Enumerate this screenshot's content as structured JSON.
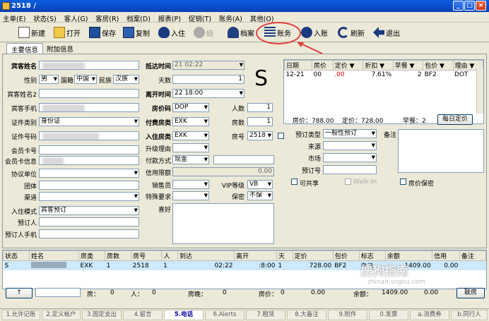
{
  "window": {
    "title": "2518 /"
  },
  "menu": [
    "主单(E)",
    "状态(S)",
    "客人(G)",
    "客房(R)",
    "档案(D)",
    "报表(P)",
    "促销(T)",
    "账务(A)",
    "其他(O)"
  ],
  "toolbar": {
    "new": "新建",
    "open": "打开",
    "save": "保存",
    "copy": "复制",
    "checkin": "入住",
    "guest": "档案",
    "account": "账务",
    "deposit": "入账",
    "refresh": "刷新",
    "exit": "退出"
  },
  "tabs": {
    "main": "主要信息",
    "extra": "附加信息"
  },
  "form": {
    "guest_name": "宾客姓名",
    "gender_label": "性别",
    "gender": "男",
    "nation_label": "国籍",
    "nation": "中国",
    "ethnic_label": "民族",
    "ethnic": "汉族",
    "guest_name2": "宾客姓名2",
    "phone": "宾客手机",
    "id_type_label": "证件类别",
    "id_type": "身份证",
    "id_no": "证件号码",
    "member_card": "会员卡号",
    "member_info": "会员卡信息",
    "unit": "协议单位",
    "group": "团体",
    "channel": "渠道",
    "checkin_mode_label": "入住模式",
    "checkin_mode": "宾客预订",
    "booker": "预订人",
    "booker_phone": "预订人手机",
    "arrive_label": "抵达时间",
    "arrive_time": "21 02:22",
    "days_label": "天数",
    "days": "1",
    "depart_label": "离开时间",
    "depart_time": "22 18:00",
    "rate_code_label": "房价码",
    "rate_code": "DOP",
    "persons_label": "人数",
    "persons": "1",
    "pay_room_label": "付费房类",
    "pay_room": "EXK",
    "rooms_label": "房数",
    "rooms": "1",
    "room_type_label": "入住房类",
    "room_type": "EXK",
    "room_no_label": "房号",
    "room_no": "2518",
    "upgrade_label": "升级理由",
    "pay_method_label": "付款方式",
    "pay_method": "现金",
    "credit_label": "信用限额",
    "credit": "0.00",
    "sales_label": "销售员",
    "vip_label": "VIP等级",
    "vip": "VB",
    "special_label": "特殊要求",
    "secret_label": "保密",
    "secret": "不保",
    "remark_label": "喜好",
    "status_big": "S",
    "book_type_label": "预订类型",
    "book_type": "一般性预订",
    "source_label": "来源",
    "market_label": "市场",
    "book_no_label": "预订号",
    "note_label": "备注",
    "share_label": "可共享",
    "walkin_label": "Walk-In",
    "secret_rate_label": "房价保密"
  },
  "rategrid": {
    "headers": [
      "日期",
      "房价",
      "定价 ▼",
      "折扣 ▼",
      "早餐 ▼",
      "包价 ▼",
      "理由 ▼"
    ],
    "rows": [
      [
        "12-21",
        "  00",
        "  .00",
        "7.61%",
        "2",
        "BF2",
        "DOT"
      ]
    ],
    "room_rate": "房价：788.00",
    "set_rate": "定价：728.00",
    "breakfast": "早餐：2",
    "daily_btn": "每日定价"
  },
  "grid2": {
    "headers": [
      "状态",
      "姓名",
      "房类",
      "房数",
      "房号",
      "人",
      "到达",
      "离开",
      "天",
      "定价",
      "包价",
      "标志",
      "余额",
      "信用",
      "备注"
    ],
    "rows": [
      [
        "S",
        "",
        "EXK",
        "1",
        "2518",
        "1",
        "02:22",
        ":8:00",
        "1",
        "728.00",
        "BF2",
        "自己",
        "1409.00",
        "0.00",
        ""
      ]
    ]
  },
  "footer": {
    "rooms": "房：",
    "rooms_v": "0",
    "persons": "人：",
    "persons_v": "0",
    "nights": "房晚：",
    "nights_v": "0",
    "rate": "房价：",
    "rate_v": "0",
    "amount": "0.00",
    "balance": "余额：",
    "balance_v": "1409.00",
    "credit_v": "0.00",
    "btn": "联房"
  },
  "bottomtabs": [
    "1.允许记账",
    "2.定义帐户",
    "3.固定支出",
    "4.留言",
    "5.电话",
    "6.Alerts",
    "7.租赁",
    "8.大备注",
    "9.附件",
    "0.发票",
    "a.消费券",
    "b.同行人"
  ],
  "watermark": "搜狗指南",
  "watermark2": "zhinan.sogou.com"
}
